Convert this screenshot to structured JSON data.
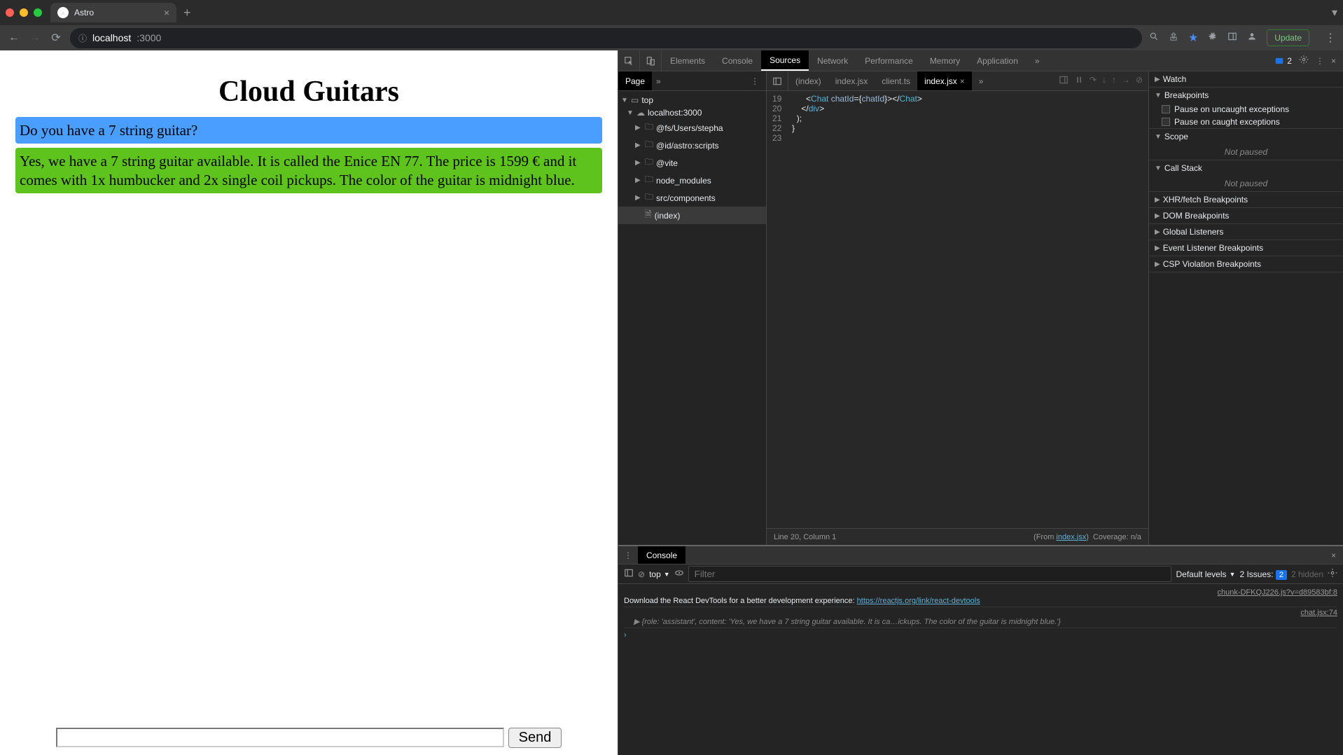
{
  "browser": {
    "tab_title": "Astro",
    "url_host": "localhost",
    "url_path": ":3000",
    "update_label": "Update"
  },
  "page": {
    "heading": "Cloud Guitars",
    "messages": [
      {
        "role": "user",
        "text": "Do you have a 7 string guitar?"
      },
      {
        "role": "assistant",
        "text": "Yes, we have a 7 string guitar available. It is called the Enice EN 77. The price is 1599 € and it comes with 1x humbucker and 2x single coil pickups. The color of the guitar is midnight blue."
      }
    ],
    "send_label": "Send"
  },
  "devtools": {
    "tabs": [
      "Elements",
      "Console",
      "Sources",
      "Network",
      "Performance",
      "Memory",
      "Application"
    ],
    "active_tab": "Sources",
    "issues_count": "2",
    "sources": {
      "sidebar_tab": "Page",
      "tree": {
        "top": "top",
        "host": "localhost:3000",
        "folders": [
          "@fs/Users/stepha",
          "@id/astro:scripts",
          "@vite",
          "node_modules",
          "src/components"
        ],
        "file": "(index)"
      },
      "open_tabs": [
        "(index)",
        "index.jsx",
        "client.ts",
        "index.jsx"
      ],
      "active_open_tab": 3,
      "code_lines": {
        "19": {
          "indent": "        ",
          "parts": [
            {
              "t": "plain",
              "v": "<"
            },
            {
              "t": "tag",
              "v": "Chat"
            },
            {
              "t": "plain",
              "v": " "
            },
            {
              "t": "attr",
              "v": "chatId"
            },
            {
              "t": "plain",
              "v": "={"
            },
            {
              "t": "attr",
              "v": "chatId"
            },
            {
              "t": "plain",
              "v": "}></"
            },
            {
              "t": "tag",
              "v": "Chat"
            },
            {
              "t": "plain",
              "v": ">"
            }
          ]
        },
        "20": {
          "indent": "      ",
          "parts": [
            {
              "t": "plain",
              "v": "</"
            },
            {
              "t": "tag",
              "v": "div"
            },
            {
              "t": "plain",
              "v": ">"
            }
          ]
        },
        "21": {
          "indent": "    ",
          "parts": [
            {
              "t": "plain",
              "v": ");"
            }
          ]
        },
        "22": {
          "indent": "  ",
          "parts": [
            {
              "t": "plain",
              "v": "}"
            }
          ]
        },
        "23": {
          "indent": "",
          "parts": []
        }
      },
      "status_line": "Line 20, Column 1",
      "status_from": "(From ",
      "status_from_link": "index.jsx",
      "status_from_suffix": ")",
      "status_coverage": "Coverage: n/a"
    },
    "debugger": {
      "sections": {
        "watch": "Watch",
        "breakpoints": "Breakpoints",
        "pause_uncaught": "Pause on uncaught exceptions",
        "pause_caught": "Pause on caught exceptions",
        "scope": "Scope",
        "not_paused": "Not paused",
        "call_stack": "Call Stack",
        "xhr": "XHR/fetch Breakpoints",
        "dom": "DOM Breakpoints",
        "listeners": "Global Listeners",
        "event_listener": "Event Listener Breakpoints",
        "csp": "CSP Violation Breakpoints"
      }
    },
    "console": {
      "tab_label": "Console",
      "context": "top",
      "filter_placeholder": "Filter",
      "levels": "Default levels",
      "issues_label": "2 Issues:",
      "issues_count": "2",
      "hidden_label": "2 hidden",
      "log1_link": "chunk-DFKQJ226.js?v=d89583bf:8",
      "log1_text": "Download the React DevTools for a better development experience: ",
      "log1_url": "https://reactjs.org/link/react-devtools",
      "log2_link": "chat.jsx:74",
      "log2_obj": "{role: 'assistant', content: 'Yes, we have a 7 string guitar available. It is ca…ickups. The color of the guitar is midnight blue.'}"
    }
  }
}
